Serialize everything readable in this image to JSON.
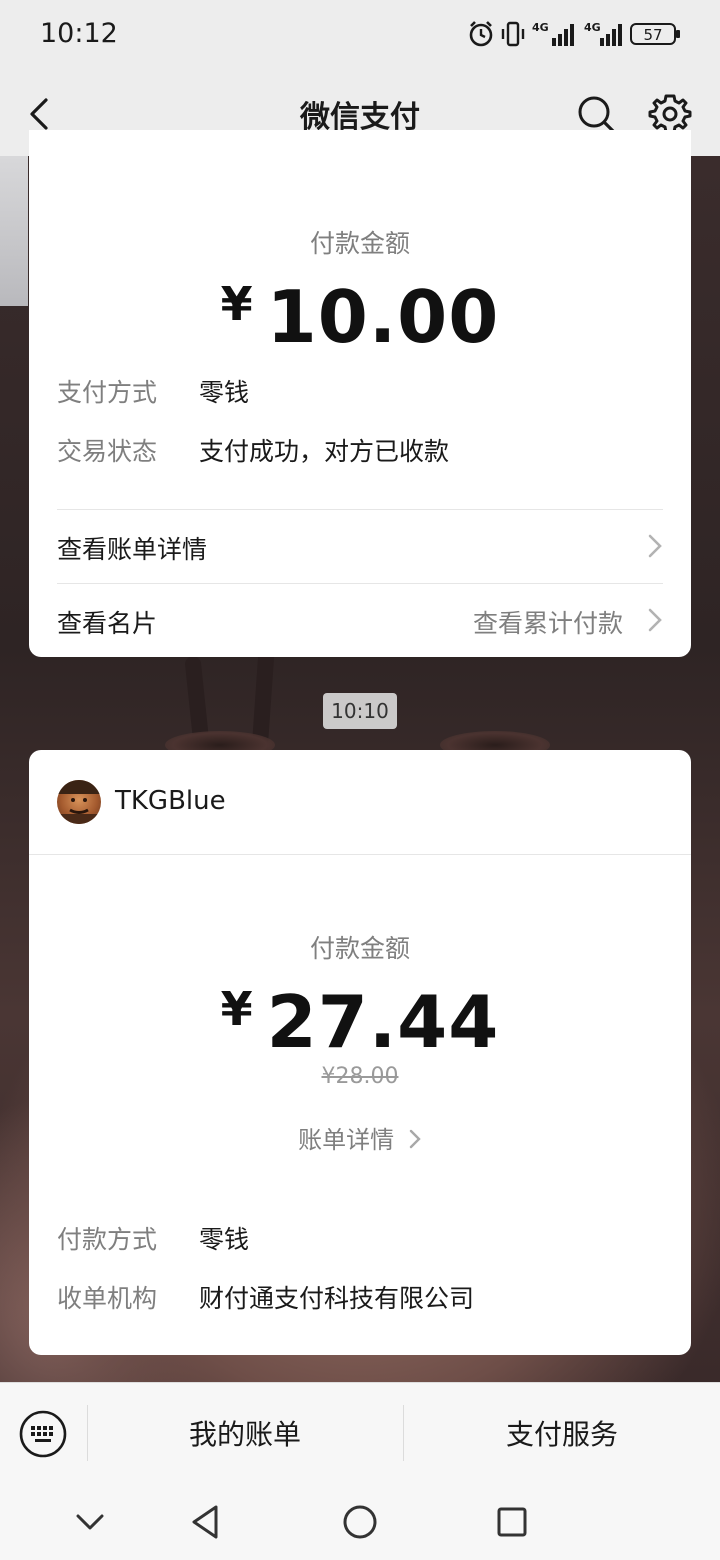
{
  "status_bar": {
    "time": "10:12",
    "network_1": "4G",
    "network_2": "4G",
    "battery": "57"
  },
  "header": {
    "title": "微信支付",
    "back_icon": "chevron-left-icon",
    "search_icon": "search-icon",
    "settings_icon": "gear-icon"
  },
  "card1": {
    "amount_label": "付款金额",
    "currency": "¥",
    "amount": "10.00",
    "details": [
      {
        "key": "支付方式",
        "value": "零钱"
      },
      {
        "key": "交易状态",
        "value": "支付成功，对方已收款"
      }
    ],
    "link_bill": "查看账单详情",
    "link_card": "查看名片",
    "link_total": "查看累计付款"
  },
  "time_divider": "10:10",
  "card2": {
    "merchant": "TKGBlue",
    "amount_label": "付款金额",
    "currency": "¥",
    "amount": "27.44",
    "original_price": "¥28.00",
    "bill_link": "账单详情",
    "details": [
      {
        "key": "付款方式",
        "value": "零钱"
      },
      {
        "key": "收单机构",
        "value": "财付通支付科技有限公司"
      }
    ]
  },
  "bottom_bar": {
    "keyboard_icon": "keyboard-icon",
    "tab1": "我的账单",
    "tab2": "支付服务"
  },
  "colors": {
    "background": "#ededed",
    "card": "#ffffff",
    "muted_text": "#7f7f7f",
    "primary_text": "#1a1a1a"
  }
}
